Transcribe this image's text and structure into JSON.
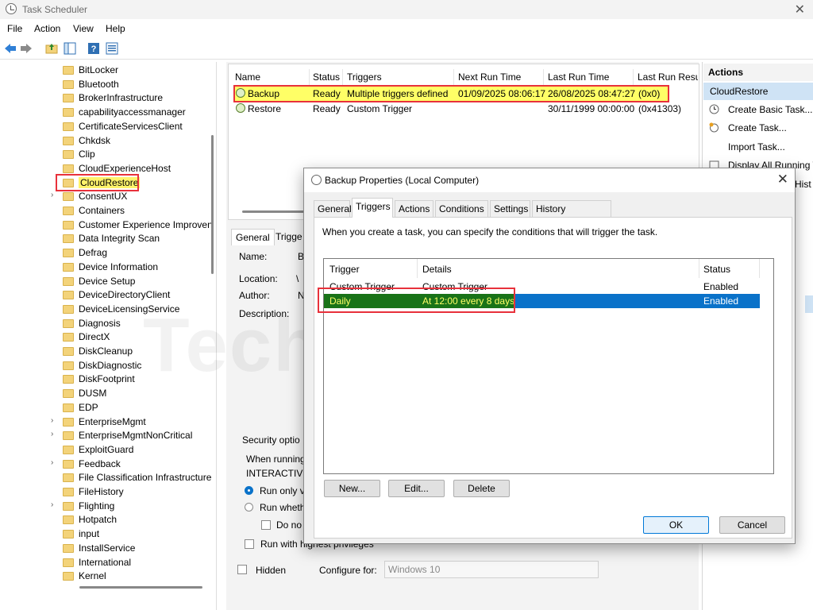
{
  "window": {
    "title": "Task Scheduler",
    "close_glyph": "✕"
  },
  "menu": [
    "File",
    "Action",
    "View",
    "Help"
  ],
  "toolbar": [
    "back-arrow-icon",
    "forward-arrow-icon",
    "folder-up-icon",
    "console-tree-icon",
    "help-icon",
    "properties-icon"
  ],
  "tree": [
    {
      "label": "BitLocker",
      "arrow": false
    },
    {
      "label": "Bluetooth",
      "arrow": false
    },
    {
      "label": "BrokerInfrastructure",
      "arrow": false
    },
    {
      "label": "capabilityaccessmanager",
      "arrow": false
    },
    {
      "label": "CertificateServicesClient",
      "arrow": false
    },
    {
      "label": "Chkdsk",
      "arrow": false
    },
    {
      "label": "Clip",
      "arrow": false
    },
    {
      "label": "CloudExperienceHost",
      "arrow": false
    },
    {
      "label": "CloudRestore",
      "arrow": false,
      "selected": true
    },
    {
      "label": "ConsentUX",
      "arrow": true
    },
    {
      "label": "Containers",
      "arrow": false
    },
    {
      "label": "Customer Experience Improven",
      "arrow": false
    },
    {
      "label": "Data Integrity Scan",
      "arrow": false
    },
    {
      "label": "Defrag",
      "arrow": false
    },
    {
      "label": "Device Information",
      "arrow": false
    },
    {
      "label": "Device Setup",
      "arrow": false
    },
    {
      "label": "DeviceDirectoryClient",
      "arrow": false
    },
    {
      "label": "DeviceLicensingService",
      "arrow": false
    },
    {
      "label": "Diagnosis",
      "arrow": false
    },
    {
      "label": "DirectX",
      "arrow": false
    },
    {
      "label": "DiskCleanup",
      "arrow": false
    },
    {
      "label": "DiskDiagnostic",
      "arrow": false
    },
    {
      "label": "DiskFootprint",
      "arrow": false
    },
    {
      "label": "DUSM",
      "arrow": false
    },
    {
      "label": "EDP",
      "arrow": false
    },
    {
      "label": "EnterpriseMgmt",
      "arrow": true
    },
    {
      "label": "EnterpriseMgmtNonCritical",
      "arrow": true
    },
    {
      "label": "ExploitGuard",
      "arrow": false
    },
    {
      "label": "Feedback",
      "arrow": true
    },
    {
      "label": "File Classification Infrastructure",
      "arrow": false
    },
    {
      "label": "FileHistory",
      "arrow": false
    },
    {
      "label": "Flighting",
      "arrow": true
    },
    {
      "label": "Hotpatch",
      "arrow": false
    },
    {
      "label": "input",
      "arrow": false
    },
    {
      "label": "InstallService",
      "arrow": false
    },
    {
      "label": "International",
      "arrow": false
    },
    {
      "label": "Kernel",
      "arrow": false
    }
  ],
  "tasklist": {
    "columns": [
      "Name",
      "Status",
      "Triggers",
      "Next Run Time",
      "Last Run Time",
      "Last Run Resu"
    ],
    "rows": [
      {
        "name": "Backup",
        "status": "Ready",
        "triggers": "Multiple triggers defined",
        "next": "01/09/2025 08:06:17",
        "last": "26/08/2025 08:47:27",
        "result": "(0x0)"
      },
      {
        "name": "Restore",
        "status": "Ready",
        "triggers": "Custom Trigger",
        "next": "",
        "last": "30/11/1999 00:00:00",
        "result": "(0x41303)"
      }
    ]
  },
  "details": {
    "tabs": [
      "General",
      "Trigge"
    ],
    "name_label": "Name:",
    "location_label": "Location:",
    "author_label": "Author:",
    "description_label": "Description:",
    "name_frag": "B",
    "location_frag": "\\",
    "author_frag": "N",
    "security_label": "Security optio",
    "when_running": "When running",
    "interactive": "INTERACTIVE",
    "run_only": "Run only v",
    "run_whether": "Run wheth",
    "do_not": "Do no",
    "highest": "Run with highest privileges",
    "hidden": "Hidden",
    "configure_for_label": "Configure for:",
    "configure_for_value": "Windows 10"
  },
  "actions": {
    "header": "Actions",
    "section": "CloudRestore",
    "items": [
      {
        "label": "Create Basic Task...",
        "icon": "create-basic-task-icon"
      },
      {
        "label": "Create Task...",
        "icon": "create-task-icon"
      },
      {
        "label": "Import Task...",
        "icon": ""
      },
      {
        "label": "Display All Running T",
        "icon": "running-tasks-icon"
      },
      {
        "label": "Hist",
        "icon": ""
      }
    ]
  },
  "dialog": {
    "title": "Backup Properties (Local Computer)",
    "close_glyph": "✕",
    "tabs": [
      "General",
      "Triggers",
      "Actions",
      "Conditions",
      "Settings",
      "History (disabled)"
    ],
    "active_tab": "Triggers",
    "description": "When you create a task, you can specify the conditions that will trigger the task.",
    "grid_columns": [
      "Trigger",
      "Details",
      "Status"
    ],
    "grid_rows": [
      {
        "trigger": "Custom Trigger",
        "details": "Custom Trigger",
        "status": "Enabled"
      },
      {
        "trigger": "Daily",
        "details": "At 12:00 every 8 days",
        "status": "Enabled",
        "selected": true
      }
    ],
    "buttons": {
      "new": "New...",
      "edit": "Edit...",
      "delete": "Delete",
      "ok": "OK",
      "cancel": "Cancel"
    }
  },
  "colors": {
    "highlight_box": "#e8313b",
    "selection_blue": "#0a72c9",
    "yellow_row": "#ffff66",
    "green_cells": "#197318"
  },
  "watermark": "TechPress.net"
}
